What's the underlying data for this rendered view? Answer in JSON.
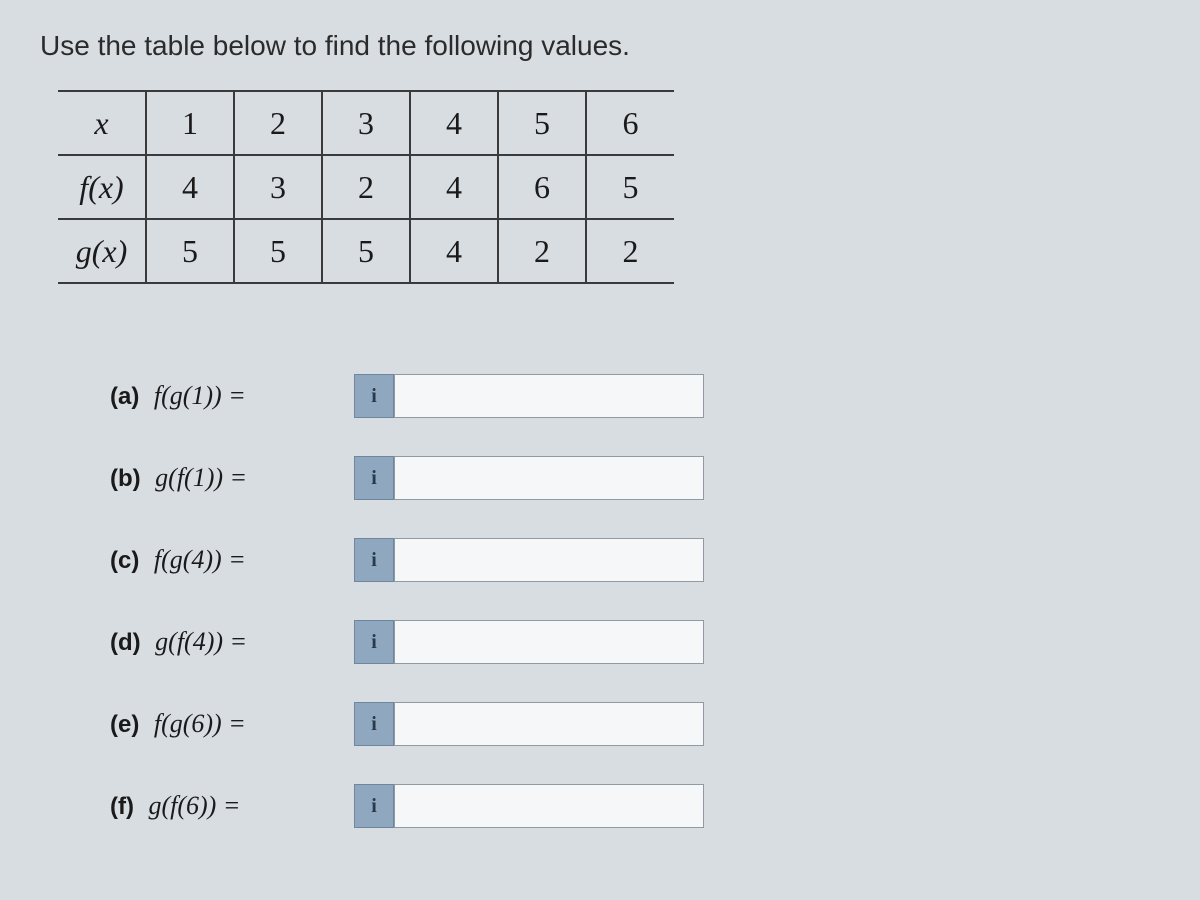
{
  "instruction": "Use the table below to find the following values.",
  "table": {
    "row_headers": [
      "x",
      "f(x)",
      "g(x)"
    ],
    "x": [
      "1",
      "2",
      "3",
      "4",
      "5",
      "6"
    ],
    "fx": [
      "4",
      "3",
      "2",
      "4",
      "6",
      "5"
    ],
    "gx": [
      "5",
      "5",
      "5",
      "4",
      "2",
      "2"
    ]
  },
  "questions": [
    {
      "letter": "(a)",
      "expr": "f(g(1)) ="
    },
    {
      "letter": "(b)",
      "expr": "g(f(1)) ="
    },
    {
      "letter": "(c)",
      "expr": "f(g(4)) ="
    },
    {
      "letter": "(d)",
      "expr": "g(f(4)) ="
    },
    {
      "letter": "(e)",
      "expr": "f(g(6)) ="
    },
    {
      "letter": "(f)",
      "expr": "g(f(6)) ="
    }
  ],
  "info_glyph": "i"
}
